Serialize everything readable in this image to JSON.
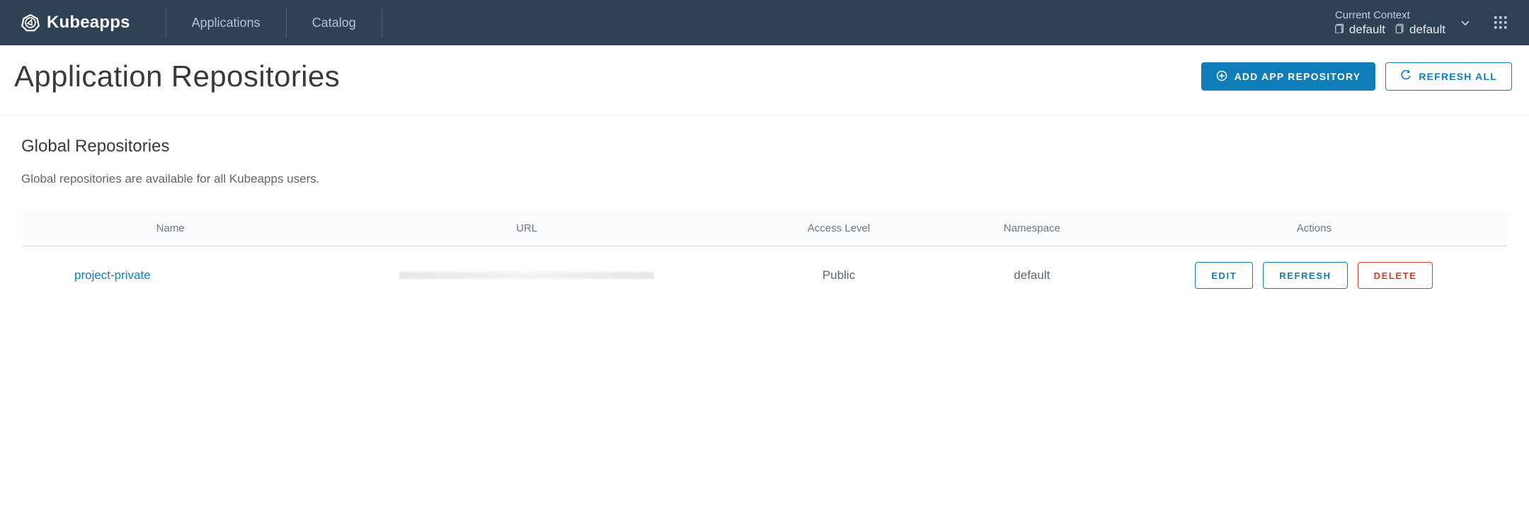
{
  "brand": {
    "name": "Kubeapps"
  },
  "nav": {
    "applications": "Applications",
    "catalog": "Catalog"
  },
  "context": {
    "label": "Current Context",
    "cluster": "default",
    "namespace": "default"
  },
  "page": {
    "title": "Application Repositories",
    "add_button": "ADD APP REPOSITORY",
    "refresh_all_button": "REFRESH ALL"
  },
  "section": {
    "title": "Global Repositories",
    "description": "Global repositories are available for all Kubeapps users."
  },
  "table": {
    "headers": {
      "name": "Name",
      "url": "URL",
      "access": "Access Level",
      "namespace": "Namespace",
      "actions": "Actions"
    },
    "row": {
      "name": "project-private",
      "access": "Public",
      "namespace": "default",
      "edit": "EDIT",
      "refresh": "REFRESH",
      "delete": "DELETE"
    }
  }
}
